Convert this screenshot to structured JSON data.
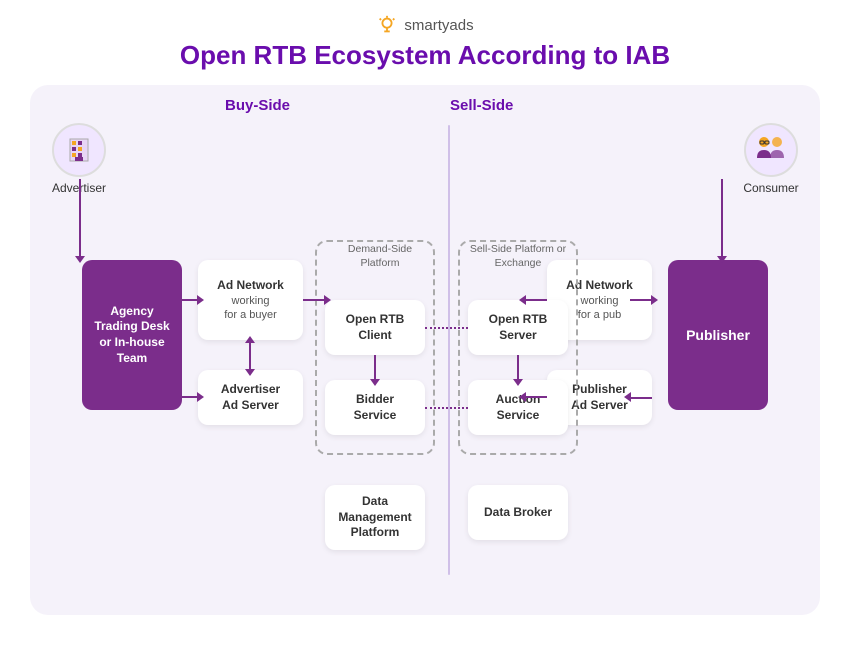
{
  "logo": {
    "text": "smartyads"
  },
  "title": "Open RTB Ecosystem According to IAB",
  "sections": {
    "buy_side": "Buy-Side",
    "sell_side": "Sell-Side"
  },
  "actors": {
    "advertiser": "Advertiser",
    "consumer": "Consumer"
  },
  "blocks": {
    "agency": "Agency\nTrading Desk\nor In-house\nTeam",
    "publisher": "Publisher",
    "ad_network_buyer": {
      "title": "Ad Network",
      "sub": "working\nfor a buyer"
    },
    "ad_network_pub": {
      "title": "Ad Network",
      "sub": "working\nfor a pub"
    },
    "advertiser_ad_server": {
      "title": "Advertiser\nAd Server"
    },
    "publisher_ad_server": {
      "title": "Publisher\nAd Server"
    },
    "dsp_label": "Demand-Side\nPlatform",
    "ssp_label": "Sell-Side\nPlatform\nor Exchange",
    "open_rtb_client": {
      "title": "Open RTB\nClient"
    },
    "open_rtb_server": {
      "title": "Open RTB\nServer"
    },
    "bidder_service": {
      "title": "Bidder\nService"
    },
    "auction_service": {
      "title": "Auction\nService"
    },
    "dmp": {
      "title": "Data\nManagement\nPlatform"
    },
    "data_broker": {
      "title": "Data Broker"
    }
  }
}
